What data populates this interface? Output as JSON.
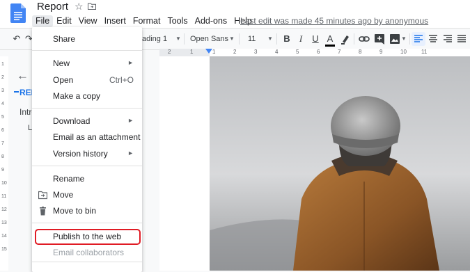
{
  "header": {
    "title": "Report",
    "last_edit": "Last edit was made 45 minutes ago by anonymous",
    "menus": [
      "File",
      "Edit",
      "View",
      "Insert",
      "Format",
      "Tools",
      "Add-ons",
      "Help"
    ],
    "active_menu": "File"
  },
  "toolbar": {
    "style_fragment": "ading 1",
    "font": "Open Sans",
    "font_size": "11"
  },
  "ruler": {
    "ticks": [
      "2",
      "1",
      "1",
      "2",
      "3",
      "4",
      "5",
      "6",
      "7",
      "8",
      "9",
      "10",
      "11"
    ]
  },
  "vruler": {
    "ticks": [
      "1",
      "2",
      "3",
      "4",
      "5",
      "6",
      "7",
      "8",
      "9",
      "10",
      "11",
      "12",
      "13",
      "14",
      "15"
    ]
  },
  "outline": {
    "items": [
      "REP",
      "Intro",
      "Lo"
    ]
  },
  "file_menu": {
    "items": [
      {
        "label": "Share",
        "shortcut": "",
        "submenu": false,
        "icon": "",
        "disabled": false
      },
      {
        "label": "New",
        "shortcut": "",
        "submenu": true,
        "icon": "",
        "disabled": false
      },
      {
        "label": "Open",
        "shortcut": "Ctrl+O",
        "submenu": false,
        "icon": "",
        "disabled": false
      },
      {
        "label": "Make a copy",
        "shortcut": "",
        "submenu": false,
        "icon": "",
        "disabled": false
      },
      {
        "label": "Download",
        "shortcut": "",
        "submenu": true,
        "icon": "",
        "disabled": false
      },
      {
        "label": "Email as an attachment",
        "shortcut": "",
        "submenu": false,
        "icon": "",
        "disabled": false
      },
      {
        "label": "Version history",
        "shortcut": "",
        "submenu": true,
        "icon": "",
        "disabled": false
      },
      {
        "label": "Rename",
        "shortcut": "",
        "submenu": false,
        "icon": "",
        "disabled": false
      },
      {
        "label": "Move",
        "shortcut": "",
        "submenu": false,
        "icon": "move-folder-icon",
        "disabled": false
      },
      {
        "label": "Move to bin",
        "shortcut": "",
        "submenu": false,
        "icon": "trash-icon",
        "disabled": false
      },
      {
        "label": "Publish to the web",
        "shortcut": "",
        "submenu": false,
        "icon": "",
        "disabled": false,
        "highlighted": true
      },
      {
        "label": "Email collaborators",
        "shortcut": "",
        "submenu": false,
        "icon": "",
        "disabled": true
      }
    ]
  },
  "colors": {
    "accent": "#1a73e8",
    "highlight": "#e01b24",
    "docs_blue": "#4285f4"
  }
}
